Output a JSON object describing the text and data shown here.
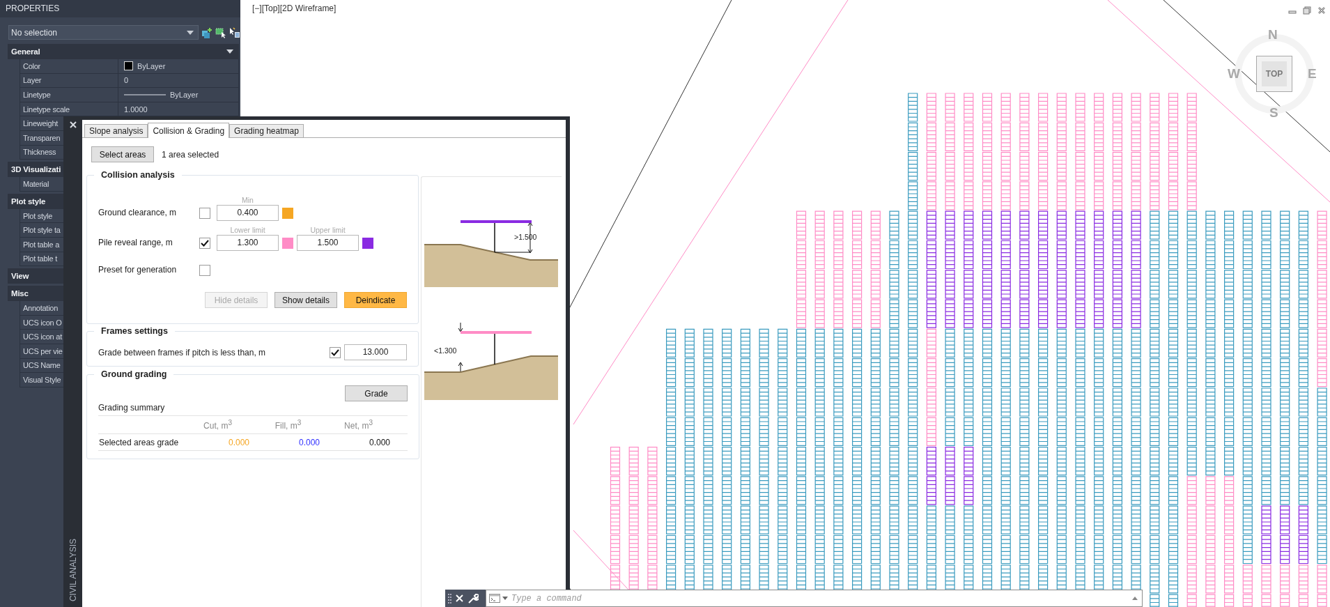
{
  "properties_panel": {
    "title": "PROPERTIES",
    "selection": "No selection",
    "groups": [
      {
        "title": "General",
        "expanded": true,
        "rows": [
          {
            "name": "Color",
            "value": "ByLayer",
            "kind": "color"
          },
          {
            "name": "Layer",
            "value": "0",
            "kind": "text"
          },
          {
            "name": "Linetype",
            "value": "ByLayer",
            "kind": "linetype"
          },
          {
            "name": "Linetype scale",
            "value": "1.0000",
            "kind": "text"
          },
          {
            "name": "Lineweight"
          },
          {
            "name": "Transparen"
          },
          {
            "name": "Thickness"
          }
        ]
      },
      {
        "title": "3D Visualizati",
        "rows": [
          {
            "name": "Material"
          }
        ]
      },
      {
        "title": "Plot style",
        "rows": [
          {
            "name": "Plot style"
          },
          {
            "name": "Plot style ta"
          },
          {
            "name": "Plot table a"
          },
          {
            "name": "Plot table t"
          }
        ]
      },
      {
        "title": "View"
      },
      {
        "title": "Misc",
        "rows": [
          {
            "name": "Annotation"
          },
          {
            "name": "UCS icon O"
          },
          {
            "name": "UCS icon at"
          },
          {
            "name": "UCS per vie"
          },
          {
            "name": "UCS Name"
          },
          {
            "name": "Visual Style"
          }
        ]
      }
    ]
  },
  "viewport": {
    "controls": [
      "[−]",
      "[Top]",
      "[2D Wireframe]"
    ],
    "compass": {
      "north": "N",
      "west": "W",
      "top": "TOP",
      "east": "E",
      "south": "S"
    }
  },
  "dialog": {
    "side_label": "CIVIL ANALYSIS",
    "tabs": [
      {
        "label": "Slope analysis",
        "selected": false
      },
      {
        "label": "Collision & Grading",
        "selected": true
      },
      {
        "label": "Grading heatmap",
        "selected": false
      }
    ],
    "select_button": "Select areas",
    "selection_status": "1 area selected",
    "collision_analysis": {
      "title": "Collision analysis",
      "rows": [
        {
          "label": "Ground clearance, m",
          "checked": false,
          "fields": [
            {
              "caption": "Min",
              "value": "0.400",
              "color": "#f5a623"
            }
          ]
        },
        {
          "label": "Pile reveal range, m",
          "checked": true,
          "fields": [
            {
              "caption": "Lower limit",
              "value": "1.300",
              "color": "#ff8cc6"
            },
            {
              "caption": "Upper limit",
              "value": "1.500",
              "color": "#8a2be2"
            }
          ]
        },
        {
          "label": "Preset for generation",
          "checked": false
        }
      ],
      "buttons": [
        {
          "label": "Hide details",
          "disabled": true,
          "kind": "default"
        },
        {
          "label": "Show details",
          "disabled": false,
          "kind": "default"
        },
        {
          "label": "Deindicate",
          "disabled": false,
          "kind": "accent"
        }
      ]
    },
    "frames_settings": {
      "title": "Frames settings",
      "label": "Grade between frames if pitch is less than, m",
      "checked": true,
      "value": "13.000"
    },
    "ground_grading": {
      "title": "Ground grading",
      "button": "Grade",
      "summary_title": "Grading summary",
      "columns": [
        "Cut, m$^{3}$",
        "Fill, m$^{3}$",
        "Net, m$^{3}$"
      ],
      "rows": [
        {
          "label": "Selected areas grade",
          "cells": [
            {
              "value": "0.000",
              "color": "#f5a623"
            },
            {
              "value": "0.000",
              "color": "#3030ff"
            },
            {
              "value": "0.000",
              "color": "#111111"
            }
          ]
        }
      ]
    },
    "illustrations": [
      {
        "kind": "above",
        "dimension": ">1.500",
        "color": "#8a2be2"
      },
      {
        "kind": "below",
        "dimension": "<1.300",
        "color": "#ff8cc6"
      }
    ]
  },
  "command_line": {
    "placeholder": "Type a command"
  }
}
